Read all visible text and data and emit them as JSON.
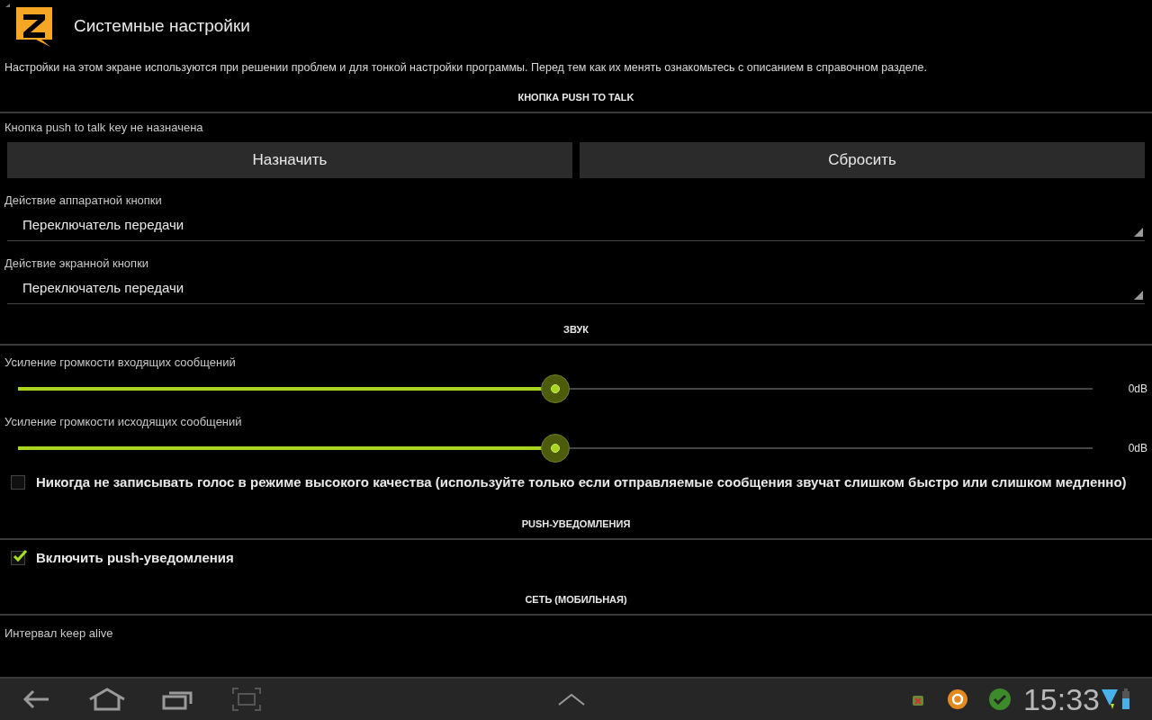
{
  "header": {
    "title": "Системные настройки"
  },
  "description": "Настройки на этом экране используются при решении проблем и для тонкой настройки программы. Перед тем как их менять ознакомьтесь с описанием в справочном разделе.",
  "sections": [
    {
      "title": "КНОПКА PUSH TO TALK",
      "items": [
        {
          "kind": "buttons",
          "label": "Кнопка push to talk key не назначена",
          "buttons": [
            "Назначить",
            "Сбросить"
          ]
        },
        {
          "kind": "spinner",
          "label": "Действие аппаратной кнопки",
          "value": "Переключатель передачи"
        },
        {
          "kind": "spinner",
          "label": "Действие экранной кнопки",
          "value": "Переключатель передачи"
        }
      ]
    },
    {
      "title": "ЗВУК",
      "items": [
        {
          "kind": "slider",
          "label": "Усиление громкости входящих сообщений",
          "level": 0.5,
          "reading": "0dB"
        },
        {
          "kind": "slider",
          "label": "Усиление громкости исходящих сообщений",
          "level": 0.5,
          "reading": "0dB"
        },
        {
          "kind": "checkbox",
          "label": "Никогда не записывать голос в режиме высокого качества (используйте только если отправляемые сообщения звучат слишком быстро или слишком медленно)",
          "checked": false
        }
      ]
    },
    {
      "title": "PUSH-УВЕДОМЛЕНИЯ",
      "items": [
        {
          "kind": "checkbox",
          "label": "Включить push-уведомления",
          "checked": true
        }
      ]
    },
    {
      "title": "СЕТЬ (МОБИЛЬНАЯ)",
      "items": [
        {
          "kind": "label",
          "label": "Интервал keep alive"
        }
      ]
    }
  ],
  "status_bar": {
    "time": "15:33"
  }
}
